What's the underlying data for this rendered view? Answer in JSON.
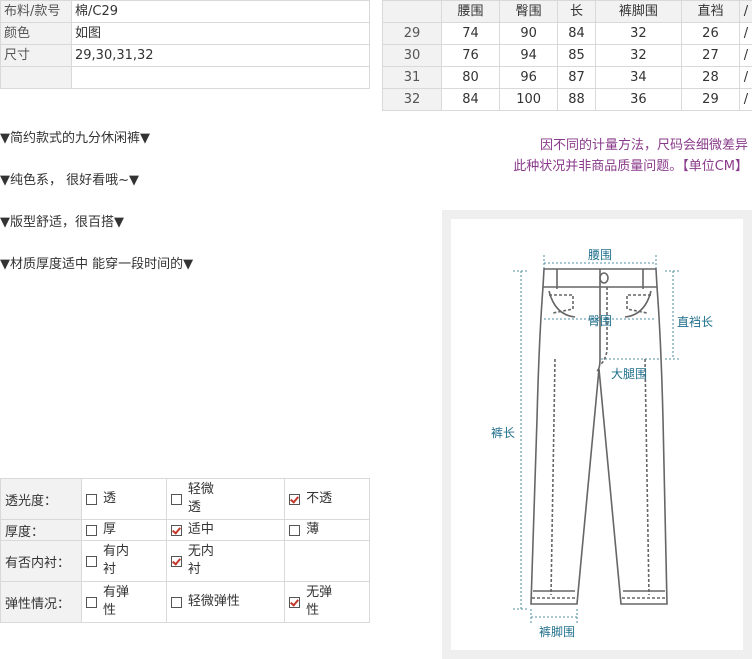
{
  "info": [
    {
      "label": "布料/款号",
      "value": "棉/C29"
    },
    {
      "label": "颜色",
      "value": "如图"
    },
    {
      "label": "尺寸",
      "value": "29,30,31,32"
    },
    {
      "label": "",
      "value": ""
    }
  ],
  "size_table": {
    "headers": [
      "腰围",
      "臀围",
      "长",
      "裤脚围",
      "直裆"
    ],
    "rows": [
      {
        "size": "29",
        "values": [
          "74",
          "90",
          "84",
          "32",
          "26"
        ]
      },
      {
        "size": "30",
        "values": [
          "76",
          "94",
          "85",
          "32",
          "27"
        ]
      },
      {
        "size": "31",
        "values": [
          "80",
          "96",
          "87",
          "34",
          "28"
        ]
      },
      {
        "size": "32",
        "values": [
          "84",
          "100",
          "88",
          "36",
          "29"
        ]
      }
    ],
    "end_mark": "/"
  },
  "notes": [
    "因不同的计量方法，尺码会细微差异",
    "此种状况并非商品质量问题。【单位CM】"
  ],
  "features": [
    "▼简约款式的九分休闲裤▼",
    "▼纯色系， 很好看哦~▼",
    "▼版型舒适，很百搭▼",
    "▼材质厚度适中 能穿一段时间的▼"
  ],
  "fabric": [
    {
      "label": "透光度：",
      "options": [
        {
          "text": "透",
          "checked": false
        },
        {
          "text": "轻微透",
          "checked": false
        },
        {
          "text": "不透",
          "checked": true
        }
      ]
    },
    {
      "label": "厚度：",
      "options": [
        {
          "text": "厚",
          "checked": false
        },
        {
          "text": "适中",
          "checked": true
        },
        {
          "text": "薄",
          "checked": false
        }
      ]
    },
    {
      "label": "有否内衬：",
      "options": [
        {
          "text": "有内衬",
          "checked": false
        },
        {
          "text": "无内衬",
          "checked": true
        },
        {
          "text": "",
          "checked": false,
          "empty": true
        }
      ]
    },
    {
      "label": "弹性情况：",
      "options": [
        {
          "text": "有弹性",
          "checked": false
        },
        {
          "text": "轻微弹性",
          "checked": false
        },
        {
          "text": "无弹性",
          "checked": true
        }
      ]
    }
  ],
  "diagram": {
    "waist": "腰围",
    "hip": "臀围",
    "rise": "直裆长",
    "thigh": "大腿围",
    "length": "裤长",
    "hem": "裤脚围",
    "line_color": "#1f6f8b",
    "pants_color": "#555555"
  }
}
